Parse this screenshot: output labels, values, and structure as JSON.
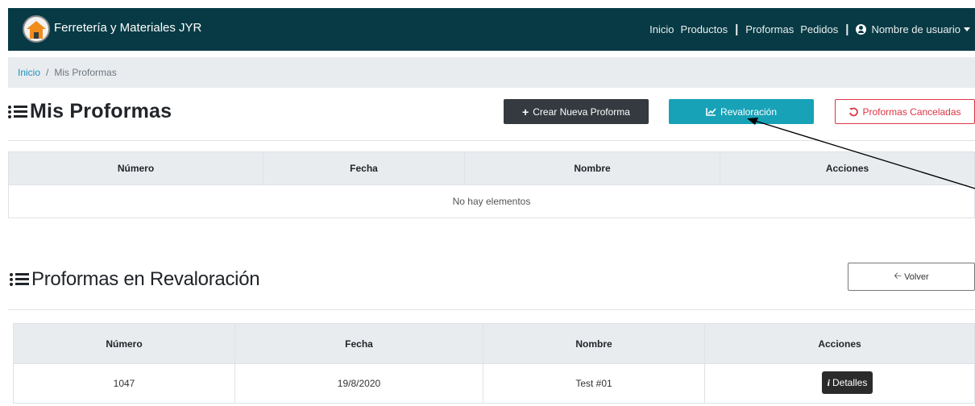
{
  "navbar": {
    "brand": "Ferretería y Materiales JYR",
    "links": [
      "Inicio",
      "Productos",
      "Proformas",
      "Pedidos"
    ],
    "user": "Nombre de usuario"
  },
  "breadcrumb": {
    "home": "Inicio",
    "separator": "/",
    "current": "Mis Proformas"
  },
  "section1": {
    "title": "Mis Proformas",
    "buttons": {
      "create": "Crear Nueva Proforma",
      "revaluation": "Revaloración",
      "cancelled": "Proformas Canceladas"
    },
    "table": {
      "headers": [
        "Número",
        "Fecha",
        "Nombre",
        "Acciones"
      ],
      "empty": "No hay elementos"
    }
  },
  "section2": {
    "title": "Proformas en Revaloración",
    "back": "Volver",
    "table": {
      "headers": [
        "Número",
        "Fecha",
        "Nombre",
        "Acciones"
      ],
      "rows": [
        {
          "numero": "1047",
          "fecha": "19/8/2020",
          "nombre": "Test #01",
          "accion": "Detalles"
        }
      ]
    }
  },
  "colors": {
    "navbar": "#073a44",
    "info": "#17a2b8",
    "danger": "#dc3545",
    "dark": "#343a40"
  }
}
